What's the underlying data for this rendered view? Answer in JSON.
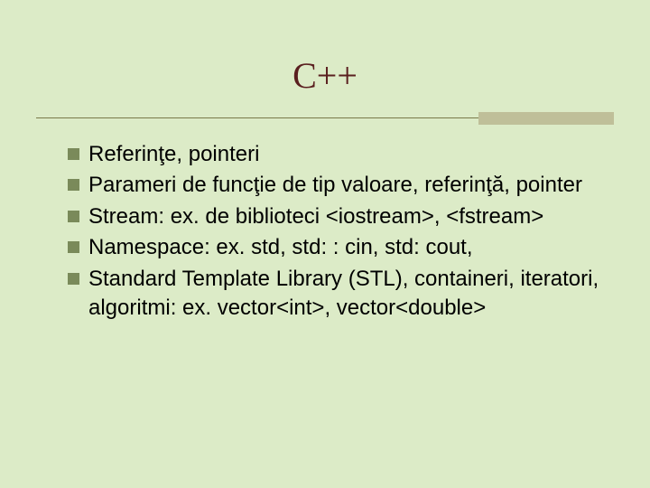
{
  "title": "C++",
  "bullets": [
    {
      "text": "Referinţe, pointeri"
    },
    {
      "text": "Parameri de funcţie de tip valoare, referinţă, pointer"
    },
    {
      "text": "Stream: ex. de biblioteci <iostream>, <fstream>"
    },
    {
      "text": "Namespace: ex. std, std: : cin, std: cout,"
    },
    {
      "text": "Standard Template Library (STL), containeri, iteratori, algoritmi: ex. vector<int>, vector<double>"
    }
  ]
}
